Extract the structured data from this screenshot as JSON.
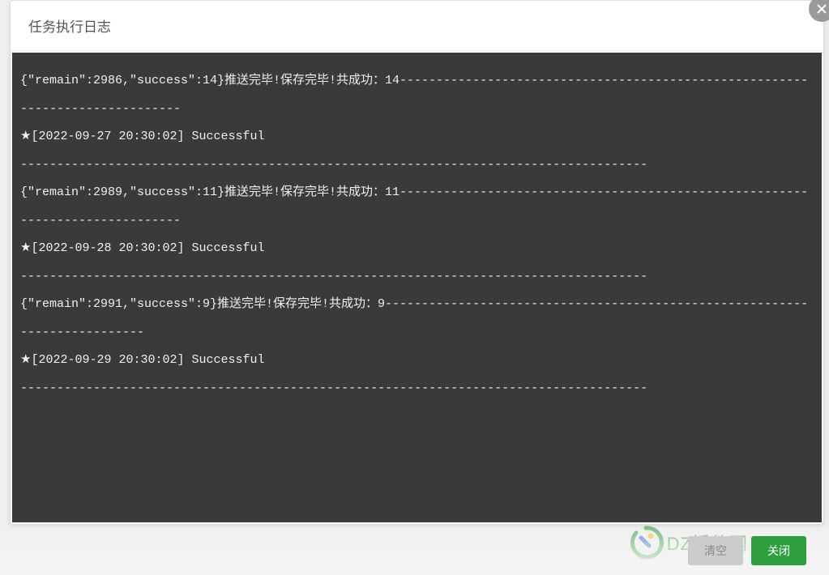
{
  "modal": {
    "title": "任务执行日志",
    "close_label": "关闭",
    "clear_label": "清空"
  },
  "log": {
    "lines": [
      "{\"remain\":2986,\"success\":14}推送完毕!保存完毕!共成功：14------------------------------------------------------------------------------",
      "★[2022-09-27 20:30:02] Successful",
      "--------------------------------------------------------------------------------------",
      "{\"remain\":2989,\"success\":11}推送完毕!保存完毕!共成功：11------------------------------------------------------------------------------",
      "★[2022-09-28 20:30:02] Successful",
      "--------------------------------------------------------------------------------------",
      "{\"remain\":2991,\"success\":9}推送完毕!保存完毕!共成功：9---------------------------------------------------------------------------",
      "★[2022-09-29 20:30:02] Successful",
      "--------------------------------------------------------------------------------------"
    ]
  },
  "watermark": {
    "text": "DZ插件网"
  }
}
